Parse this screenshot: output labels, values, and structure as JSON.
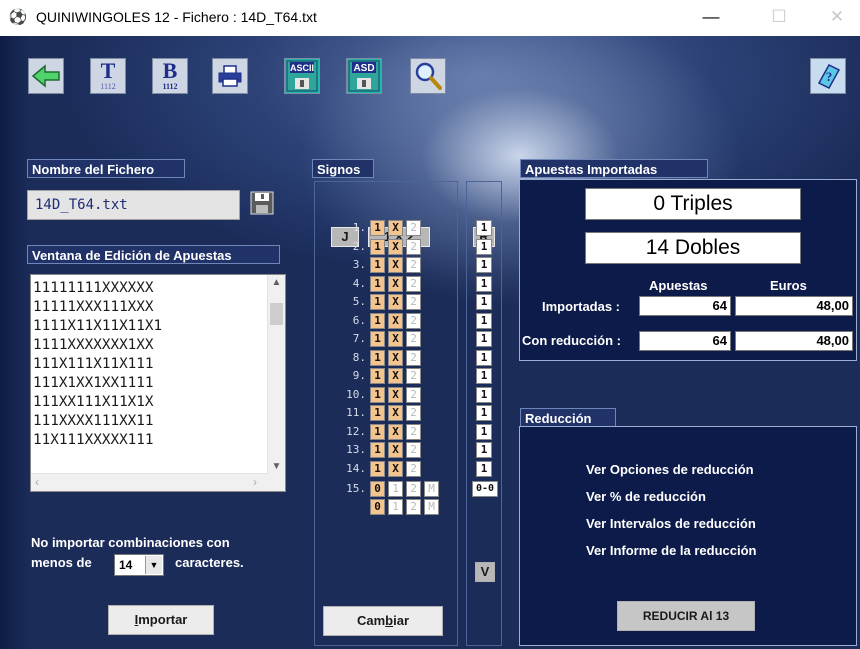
{
  "window": {
    "title": "QUINIWINGOLES 12 - Fichero : 14D_T64.txt",
    "minimize": "—",
    "maximize": "☐",
    "close": "✕"
  },
  "toolbar": {
    "icons": [
      "back-arrow-icon",
      "t-1112-icon",
      "b-1112-icon",
      "printer-icon",
      "ascii-disk-icon",
      "asd-disk-icon",
      "magnifier-icon",
      "help-book-icon"
    ],
    "t_big": "T",
    "t_small": "1112",
    "b_big": "B",
    "b_small": "1112",
    "ascii_label": "ASCII",
    "asd_label": "ASD"
  },
  "fichero": {
    "header": "Nombre del Fichero",
    "filename": "14D_T64.txt",
    "save_icon": "floppy-disk-icon"
  },
  "editor": {
    "header": "Ventana de Edición de Apuestas",
    "lines": [
      "11111111XXXXXX",
      "11111XXX111XXX",
      "1111X11X11X11X1",
      "1111XXXXXXX1XX",
      "111X111X11X111",
      "111X1XX1XX1111",
      "111XX111X11X1X",
      "111XXXX111XX11",
      "11X111XXXXX111"
    ]
  },
  "options": {
    "line1": "No importar combinaciones con",
    "line2_pre": "menos de",
    "min_chars": "14",
    "line2_post": "caracteres."
  },
  "buttons": {
    "importar": "Importar",
    "importar_key": "I",
    "importar_rest": "mportar",
    "cambiar_pre": "Cam",
    "cambiar_key": "b",
    "cambiar_post": "iar",
    "reducir": "REDUCIR Al 13",
    "v": "V"
  },
  "signos": {
    "header": "Signos",
    "j_label": "J",
    "cols_label": "1 X 2",
    "r_label": "R",
    "rows": [
      {
        "num": "1.",
        "s1": "1",
        "sx": "X",
        "s2": "2",
        "r": "1"
      },
      {
        "num": "2.",
        "s1": "1",
        "sx": "X",
        "s2": "2",
        "r": "1"
      },
      {
        "num": "3.",
        "s1": "1",
        "sx": "X",
        "s2": "2",
        "r": "1"
      },
      {
        "num": "4.",
        "s1": "1",
        "sx": "X",
        "s2": "2",
        "r": "1"
      },
      {
        "num": "5.",
        "s1": "1",
        "sx": "X",
        "s2": "2",
        "r": "1"
      },
      {
        "num": "6.",
        "s1": "1",
        "sx": "X",
        "s2": "2",
        "r": "1"
      },
      {
        "num": "7.",
        "s1": "1",
        "sx": "X",
        "s2": "2",
        "r": "1"
      },
      {
        "num": "8.",
        "s1": "1",
        "sx": "X",
        "s2": "2",
        "r": "1"
      },
      {
        "num": "9.",
        "s1": "1",
        "sx": "X",
        "s2": "2",
        "r": "1"
      },
      {
        "num": "10.",
        "s1": "1",
        "sx": "X",
        "s2": "2",
        "r": "1"
      },
      {
        "num": "11.",
        "s1": "1",
        "sx": "X",
        "s2": "2",
        "r": "1"
      },
      {
        "num": "12.",
        "s1": "1",
        "sx": "X",
        "s2": "2",
        "r": "1"
      },
      {
        "num": "13.",
        "s1": "1",
        "sx": "X",
        "s2": "2",
        "r": "1"
      },
      {
        "num": "14.",
        "s1": "1",
        "sx": "X",
        "s2": "2",
        "r": "1"
      }
    ],
    "row15": {
      "num": "15.",
      "a": [
        "0",
        "1",
        "2",
        "M"
      ],
      "b": [
        "0",
        "1",
        "2",
        "M"
      ],
      "r": "0-0"
    }
  },
  "apuestas": {
    "header": "Apuestas Importadas",
    "triples": "0 Triples",
    "dobles": "14 Dobles",
    "col_apuestas": "Apuestas",
    "col_euros": "Euros",
    "row_importadas": "Importadas :",
    "row_reduccion": "Con reducción :",
    "imp_apuestas": "64",
    "imp_euros": "48,00",
    "red_apuestas": "64",
    "red_euros": "48,00"
  },
  "reduccion": {
    "header": "Reducción",
    "links": [
      "Ver Opciones de reducción",
      "Ver % de reducción",
      "Ver Intervalos de reducción",
      "Ver Informe de la reducción"
    ]
  },
  "colors": {
    "panel_header": "#203268",
    "selected_cell": "#f3c48d",
    "background": "#1b2c59"
  }
}
